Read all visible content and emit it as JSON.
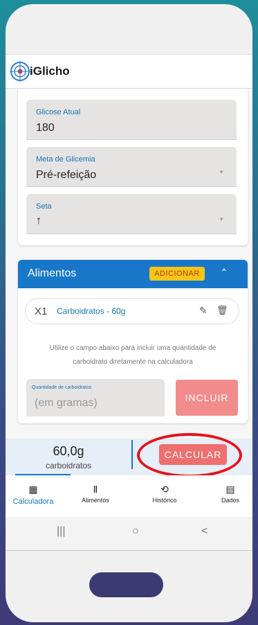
{
  "app": {
    "title": "iGlicho"
  },
  "form": {
    "glucose": {
      "label": "Glicose Atual",
      "value": "180"
    },
    "target": {
      "label": "Meta de Glicemia",
      "value": "Pré-refeição"
    },
    "arrow": {
      "label": "Seta",
      "value": "↑"
    }
  },
  "foods": {
    "title": "Alimentos",
    "add_label": "ADICIONAR",
    "items": [
      {
        "qty": "X1",
        "name": "Carboidratos - 60g"
      }
    ],
    "info": "Utilize o campo abaixo para incluir uma quantidade de carboidrato diretamente na calculadora",
    "carb_label": "Quantidade de carboidratos",
    "carb_placeholder": "(em gramas)",
    "include_label": "INCLUIR"
  },
  "summary": {
    "value": "60,0g",
    "unit": "carboidratos",
    "calc_label": "CALCULAR"
  },
  "nav": [
    {
      "label": "Calculadora",
      "icon": "calculator-icon",
      "glyph": "▦",
      "active": true
    },
    {
      "label": "Alimentos",
      "icon": "fork-knife-icon",
      "glyph": "Ⅱ",
      "active": false
    },
    {
      "label": "Histórico",
      "icon": "history-icon",
      "glyph": "⟲",
      "active": false
    },
    {
      "label": "Dados",
      "icon": "clipboard-icon",
      "glyph": "▤",
      "active": false
    }
  ],
  "system": {
    "recents": "|||",
    "home": "○",
    "back": "<"
  },
  "colors": {
    "primary": "#1877c9",
    "accent": "#f5c518",
    "danger": "#ef6f6f",
    "highlight": "#e3141b"
  }
}
